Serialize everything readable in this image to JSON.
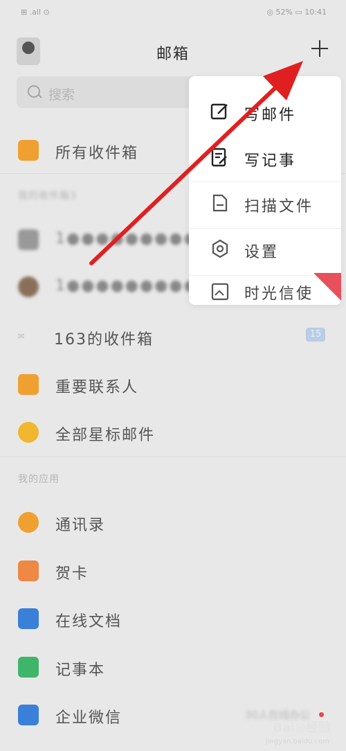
{
  "status": {
    "left": "⊞ .all ⊙",
    "right": "◎ 52% ▭ 10:41"
  },
  "header": {
    "title": "邮箱"
  },
  "search": {
    "placeholder": "搜索"
  },
  "inbox": {
    "all": "所有收件箱",
    "my_section": "我的收件箱3"
  },
  "accounts": [
    {
      "label": "1●●●●●●●●●●●●●●●●@"
    },
    {
      "label": "1●●●●●●●●●●●●●●●●@"
    }
  ],
  "folders": {
    "box163": "163的收件箱",
    "box163_badge": "15",
    "important": "重要联系人",
    "starred": "全部星标邮件"
  },
  "apps": {
    "section": "我的应用",
    "contacts": "通讯录",
    "card": "贺卡",
    "docs": "在线文档",
    "notes": "记事本",
    "wework": "企业微信",
    "wework_note": "30人在线办公"
  },
  "menu": {
    "compose": "写邮件",
    "note": "写记事",
    "scan": "扫描文件",
    "settings": "设置",
    "time_letter": "时光信使"
  },
  "watermark": {
    "brand": "Bai◎经验",
    "site": "jingyan.baidu.com"
  },
  "colors": {
    "arrow": "#e02020",
    "accent_orange": "#f0a030",
    "accent_blue": "#3a7fd8",
    "accent_green": "#3fb56a"
  }
}
